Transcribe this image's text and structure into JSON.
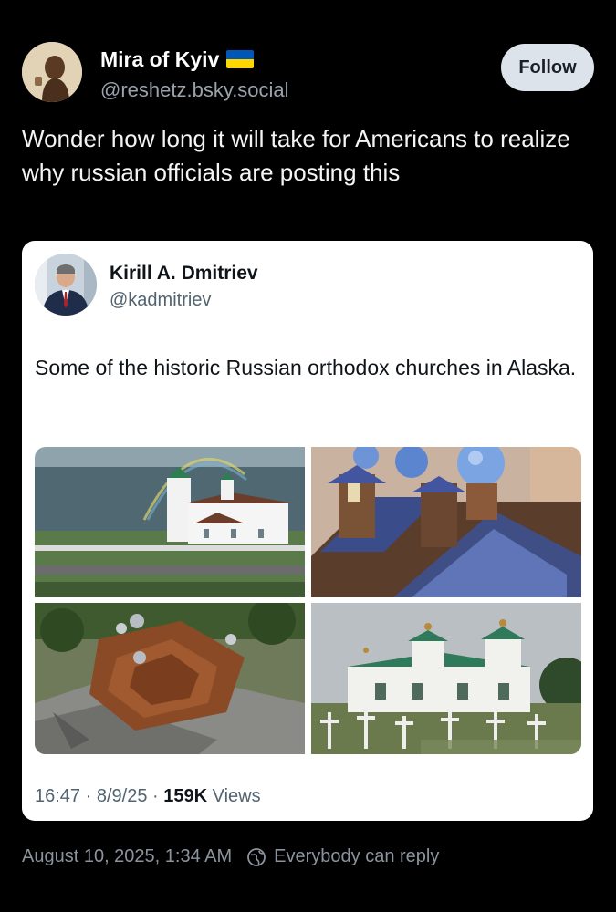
{
  "post": {
    "author": {
      "name": "Mira of Kyiv",
      "flag_icon": "ukraine-flag-icon",
      "handle": "@reshetz.bsky.social"
    },
    "follow_label": "Follow",
    "text": "Wonder how long it will take for Americans to realize why russian officials are posting this",
    "footer": {
      "timestamp": "August 10, 2025, 1:34 AM",
      "reply_icon": "globe-icon",
      "reply_setting": "Everybody can reply"
    }
  },
  "quote": {
    "author": {
      "name": "Kirill A. Dmitriev",
      "handle": "@kadmitriev"
    },
    "text": "Some of the historic Russian orthodox churches in Alaska.",
    "meta": {
      "time": "16:47",
      "sep1": " · ",
      "date": "8/9/25",
      "sep2": " · ",
      "views_count": "159K",
      "views_label": " Views"
    }
  },
  "colors": {
    "background": "#000000",
    "card_background": "#ffffff",
    "follow_button": "#dde3ea",
    "muted_text": "#9aa3ad",
    "flag_blue": "#0057b7",
    "flag_yellow": "#ffd700"
  }
}
